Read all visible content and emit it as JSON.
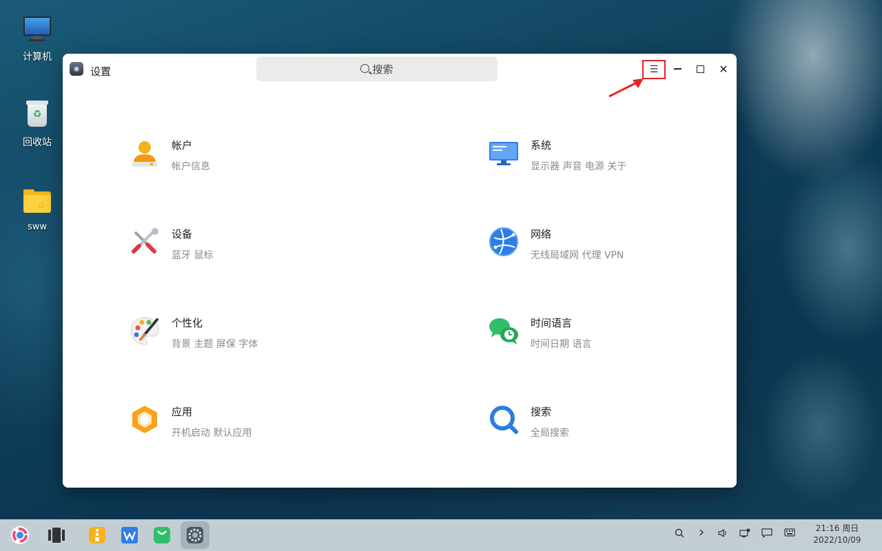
{
  "desktop": {
    "icons": [
      {
        "label": "计算机"
      },
      {
        "label": "回收站"
      },
      {
        "label": "sww"
      }
    ]
  },
  "window": {
    "title": "设置",
    "search_placeholder": "搜索",
    "menu_glyph": "☰",
    "close_glyph": "✕"
  },
  "settings": [
    {
      "name": "帐户",
      "desc": "帐户信息"
    },
    {
      "name": "系统",
      "desc": "显示器 声音 电源 关于"
    },
    {
      "name": "设备",
      "desc": "蓝牙 鼠标"
    },
    {
      "name": "网络",
      "desc": "无线局域网 代理 VPN"
    },
    {
      "name": "个性化",
      "desc": "背景 主题 屏保 字体"
    },
    {
      "name": "时间语言",
      "desc": "时间日期 语言"
    },
    {
      "name": "应用",
      "desc": "开机启动 默认应用"
    },
    {
      "name": "搜索",
      "desc": "全局搜索"
    }
  ],
  "taskbar": {
    "time": "21:16 周日",
    "date": "2022/10/09"
  },
  "colors": {
    "highlight": "#e02424",
    "accent_blue": "#2b7de0"
  }
}
